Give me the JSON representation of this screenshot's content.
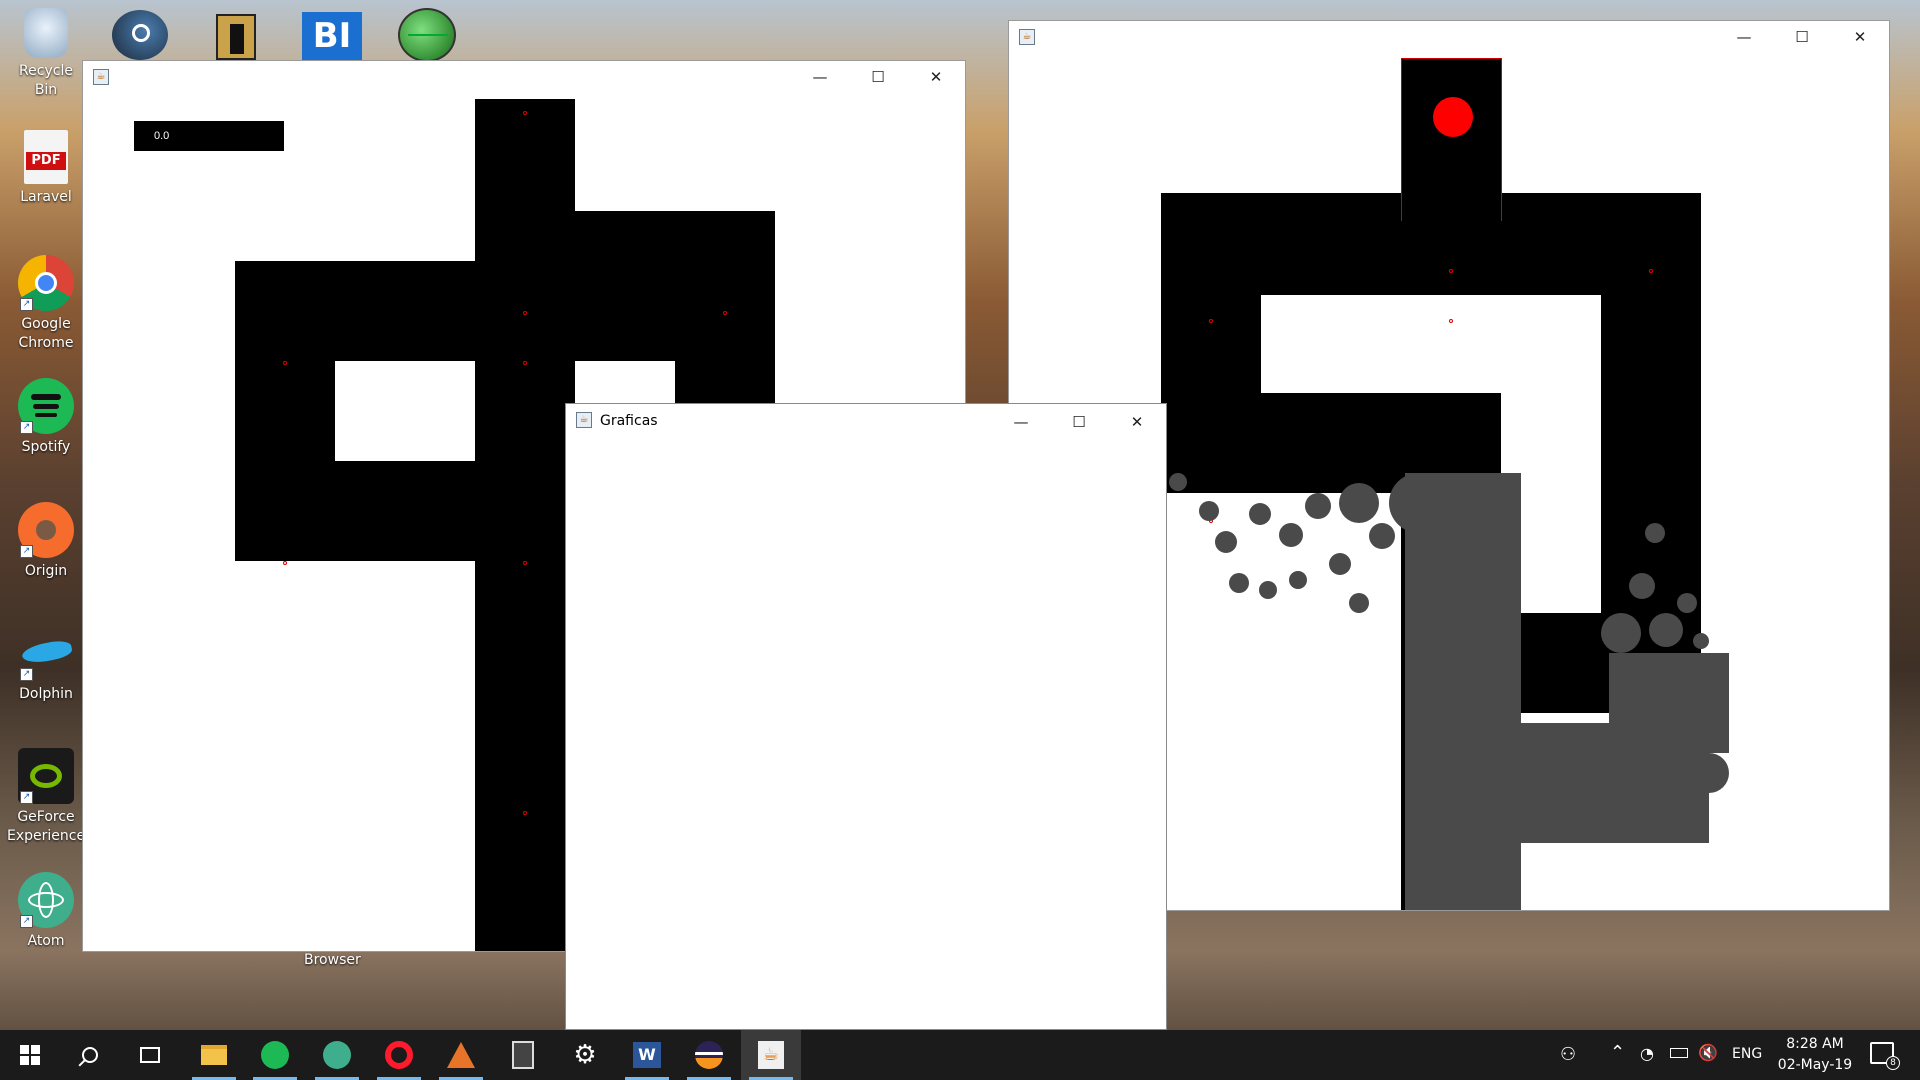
{
  "desktop": {
    "icons": [
      {
        "label": "Recycle Bin",
        "icon": "recycle-bin-icon"
      },
      {
        "label": "Laravel",
        "icon": "pdf-icon",
        "badge": "PDF"
      },
      {
        "label": "Google Chrome",
        "icon": "chrome-icon"
      },
      {
        "label": "Spotify",
        "icon": "spotify-icon"
      },
      {
        "label": "Origin",
        "icon": "origin-icon"
      },
      {
        "label": "Dolphin",
        "icon": "dolphin-icon"
      },
      {
        "label": "GeForce Experience",
        "icon": "geforce-icon"
      },
      {
        "label": "Atom",
        "icon": "atom-icon"
      }
    ],
    "top_icons": [
      {
        "icon": "steam-icon"
      },
      {
        "icon": "folder-icon"
      },
      {
        "icon": "bi-icon",
        "text": "BI"
      },
      {
        "icon": "globe-icon"
      }
    ],
    "browser_label": "Browser"
  },
  "window_left": {
    "score": "0.0"
  },
  "window_graficas": {
    "title": "Graficas"
  },
  "window_right": {},
  "controls": {
    "minimize": "—",
    "maximize": "☐",
    "close": "✕"
  },
  "taskbar": {
    "items": [
      {
        "name": "start-button",
        "icon": "windows-icon"
      },
      {
        "name": "search-button",
        "icon": "search-icon"
      },
      {
        "name": "task-view-button",
        "icon": "task-view-icon"
      },
      {
        "name": "taskbar-file-explorer",
        "icon": "folder-icon"
      },
      {
        "name": "taskbar-spotify",
        "icon": "spotify-icon"
      },
      {
        "name": "taskbar-atom",
        "icon": "atom-icon"
      },
      {
        "name": "taskbar-opera",
        "icon": "opera-icon"
      },
      {
        "name": "taskbar-matlab",
        "icon": "matlab-icon"
      },
      {
        "name": "taskbar-calculator",
        "icon": "calculator-icon"
      },
      {
        "name": "taskbar-settings",
        "icon": "gear-icon"
      },
      {
        "name": "taskbar-word",
        "icon": "word-icon"
      },
      {
        "name": "taskbar-eclipse",
        "icon": "eclipse-icon"
      },
      {
        "name": "taskbar-java",
        "icon": "java-icon"
      }
    ],
    "language": "ENG",
    "time": "8:28 AM",
    "date": "02-May-19",
    "notifications": "8"
  }
}
